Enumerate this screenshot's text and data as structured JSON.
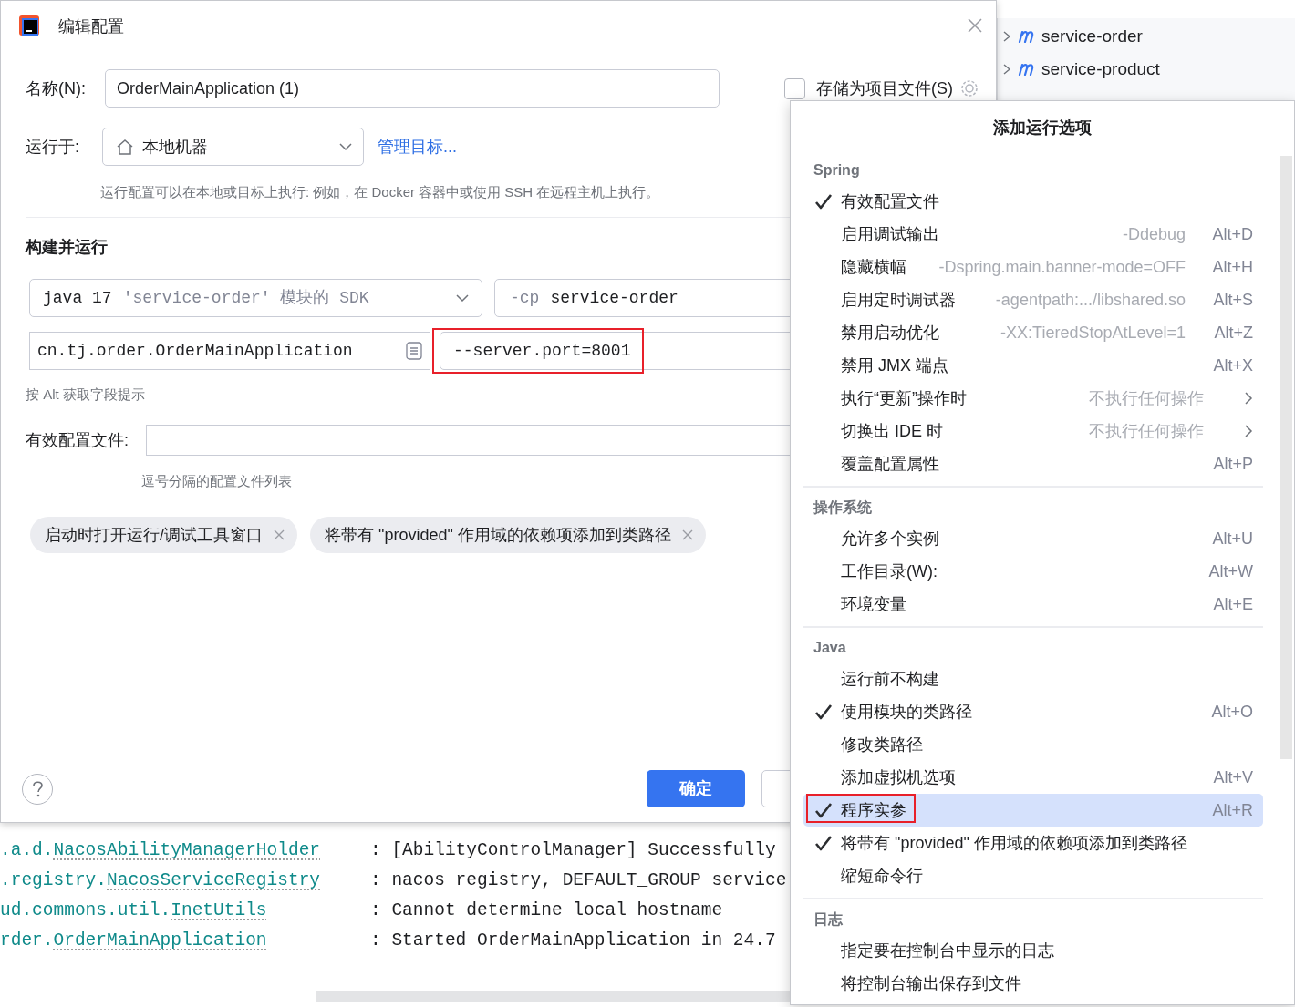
{
  "project_tree": [
    {
      "label": "service-order"
    },
    {
      "label": "service-product"
    }
  ],
  "console": {
    "lines": [
      {
        "prefix": ".a.d.",
        "logger": "NacosAbilityManagerHolder",
        "message": ": [AbilityControlManager] Successfully"
      },
      {
        "prefix": ".registry.",
        "logger": "NacosServiceRegistry",
        "message": ": nacos registry, DEFAULT_GROUP service"
      },
      {
        "prefix": "ud.commons.util.",
        "logger": "InetUtils",
        "message": ": Cannot determine local hostname"
      },
      {
        "prefix": "rder.",
        "logger": "OrderMainApplication",
        "message": ": Started OrderMainApplication in 24.7"
      }
    ]
  },
  "dialog": {
    "title": "编辑配置",
    "name": {
      "label": "名称(N):",
      "value": "OrderMainApplication (1)"
    },
    "store_as_project_file": {
      "label": "存储为项目文件(S)",
      "checked": false
    },
    "run_on": {
      "label": "运行于:",
      "value": "本地机器",
      "link": "管理目标...",
      "hint": "运行配置可以在本地或目标上执行: 例如，在 Docker 容器中或使用 SSH 在远程主机上执行。"
    },
    "section": "构建并运行",
    "sdk": {
      "value": "java 17",
      "detail": "'service-order' 模块的 SDK"
    },
    "classpath": {
      "flag": "-cp",
      "value": "service-order"
    },
    "main_class": "cn.tj.order.OrderMainApplication",
    "program_args": {
      "value": "--server.port=8001",
      "highlighted": true
    },
    "field_hint": "按 Alt 获取字段提示",
    "profiles": {
      "label": "有效配置文件:",
      "hint": "逗号分隔的配置文件列表"
    },
    "chips": [
      "启动时打开运行/调试工具窗口",
      "将带有 \"provided\" 作用域的依赖项添加到类路径"
    ],
    "ok_button": "确定"
  },
  "menu": {
    "title": "添加运行选项",
    "groups": [
      {
        "name": "Spring",
        "items": [
          {
            "label": "有效配置文件",
            "checked": true,
            "selected": false,
            "highlighted": false
          },
          {
            "label": "启用调试输出",
            "hint": "-Ddebug",
            "shortcut": "Alt+D",
            "checked": false,
            "selected": false,
            "highlighted": false
          },
          {
            "label": "隐藏横幅",
            "hint": "-Dspring.main.banner-mode=OFF",
            "shortcut": "Alt+H",
            "checked": false,
            "selected": false,
            "highlighted": false
          },
          {
            "label": "启用定时调试器",
            "hint": "-agentpath:.../libshared.so",
            "shortcut": "Alt+S",
            "checked": false,
            "selected": false,
            "highlighted": false
          },
          {
            "label": "禁用启动优化",
            "hint": "-XX:TieredStopAtLevel=1",
            "shortcut": "Alt+Z",
            "checked": false,
            "selected": false,
            "highlighted": false
          },
          {
            "label": "禁用 JMX 端点",
            "shortcut": "Alt+X",
            "checked": false,
            "selected": false,
            "highlighted": false
          },
          {
            "label": "执行“更新”操作时",
            "hint": "不执行任何操作",
            "submenu": true,
            "checked": false,
            "selected": false,
            "highlighted": false
          },
          {
            "label": "切换出 IDE 时",
            "hint": "不执行任何操作",
            "submenu": true,
            "checked": false,
            "selected": false,
            "highlighted": false
          },
          {
            "label": "覆盖配置属性",
            "shortcut": "Alt+P",
            "checked": false,
            "selected": false,
            "highlighted": false
          }
        ]
      },
      {
        "name": "操作系统",
        "items": [
          {
            "label": "允许多个实例",
            "shortcut": "Alt+U",
            "checked": false,
            "selected": false,
            "highlighted": false
          },
          {
            "label": "工作目录(W):",
            "shortcut": "Alt+W",
            "checked": false,
            "selected": false,
            "highlighted": false
          },
          {
            "label": "环境变量",
            "shortcut": "Alt+E",
            "checked": false,
            "selected": false,
            "highlighted": false
          }
        ]
      },
      {
        "name": "Java",
        "items": [
          {
            "label": "运行前不构建",
            "checked": false,
            "selected": false,
            "highlighted": false
          },
          {
            "label": "使用模块的类路径",
            "shortcut": "Alt+O",
            "checked": true,
            "selected": false,
            "highlighted": false
          },
          {
            "label": "修改类路径",
            "checked": false,
            "selected": false,
            "highlighted": false
          },
          {
            "label": "添加虚拟机选项",
            "shortcut": "Alt+V",
            "checked": false,
            "selected": false,
            "highlighted": false
          },
          {
            "label": "程序实参",
            "shortcut": "Alt+R",
            "checked": true,
            "selected": true,
            "highlighted": true
          },
          {
            "label": "将带有 \"provided\" 作用域的依赖项添加到类路径",
            "checked": true,
            "selected": false,
            "highlighted": false
          },
          {
            "label": "缩短命令行",
            "checked": false,
            "selected": false,
            "highlighted": false
          }
        ]
      },
      {
        "name": "日志",
        "items": [
          {
            "label": "指定要在控制台中显示的日志",
            "checked": false,
            "selected": false,
            "highlighted": false
          },
          {
            "label": "将控制台输出保存到文件",
            "checked": false,
            "selected": false,
            "highlighted": false
          }
        ]
      }
    ]
  }
}
